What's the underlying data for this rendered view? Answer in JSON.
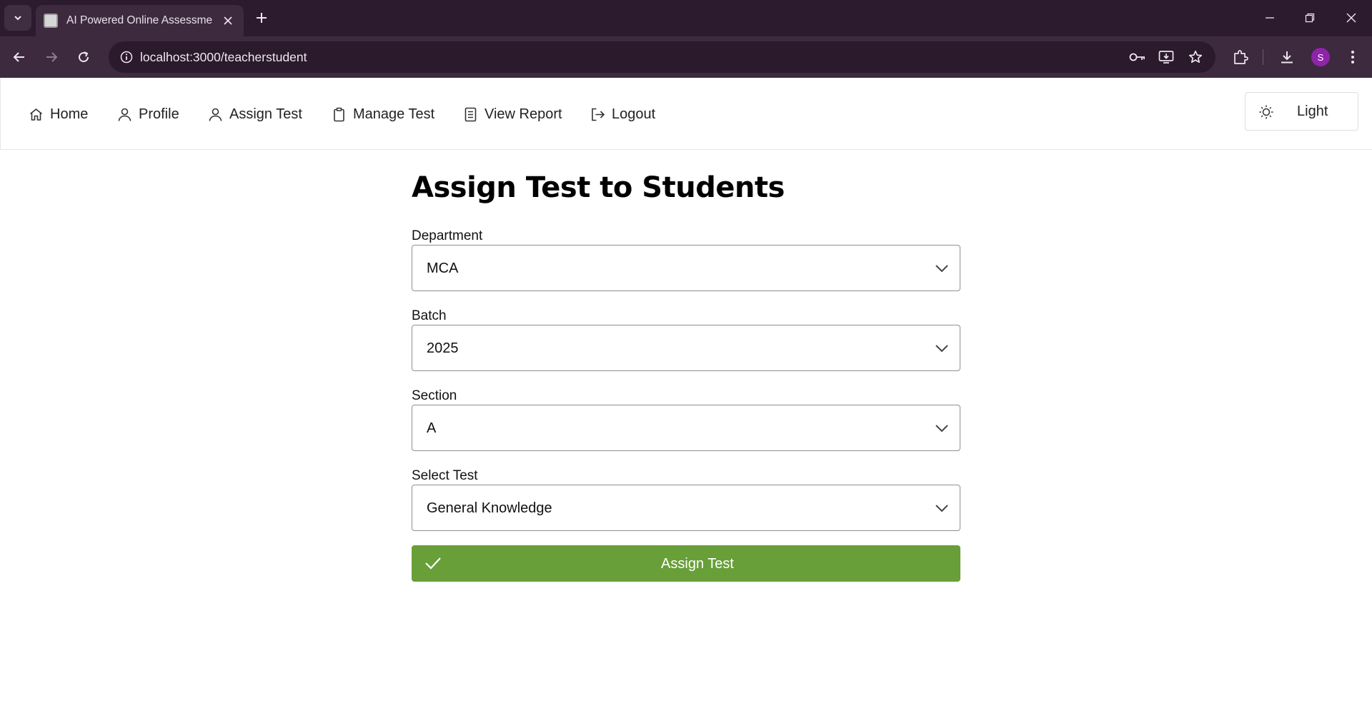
{
  "browser": {
    "tab_title": "AI Powered Online Assessment",
    "url": "localhost:3000/teacherstudent",
    "profile_initial": "S"
  },
  "nav": {
    "items": [
      {
        "label": "Home",
        "icon": "home-icon"
      },
      {
        "label": "Profile",
        "icon": "user-icon"
      },
      {
        "label": "Assign Test",
        "icon": "user-icon"
      },
      {
        "label": "Manage Test",
        "icon": "clipboard-icon"
      },
      {
        "label": "View Report",
        "icon": "file-icon"
      },
      {
        "label": "Logout",
        "icon": "sign-out-icon"
      }
    ],
    "theme_label": "Light"
  },
  "form": {
    "title": "Assign Test to Students",
    "department": {
      "label": "Department",
      "value": "MCA"
    },
    "batch": {
      "label": "Batch",
      "value": "2025"
    },
    "section": {
      "label": "Section",
      "value": "A"
    },
    "test": {
      "label": "Select Test",
      "value": "General Knowledge"
    },
    "submit_label": "Assign Test"
  },
  "colors": {
    "accent_green": "#689f38",
    "chrome_dark": "#2c1b2e",
    "chrome_toolbar": "#3d2a3f",
    "avatar": "#8e24aa"
  }
}
